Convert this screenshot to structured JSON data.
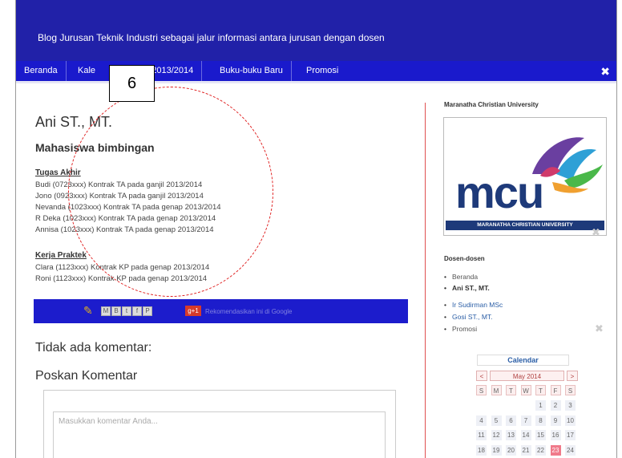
{
  "header": {
    "text": "Blog Jurusan Teknik Industri sebagai jalur informasi antara jurusan dengan dosen"
  },
  "nav": {
    "items": [
      "Beranda",
      "Kalender Akademik 2013/2014",
      "Buku-buku Baru",
      "Promosi"
    ],
    "visible_items": [
      "Beranda",
      "Kale",
      "emik 2013/2014",
      "Buku-buku Baru",
      "Promosi"
    ],
    "tools_icon": "tools-icon"
  },
  "annotation": {
    "number": "6"
  },
  "post": {
    "title": "Ani ST., MT.",
    "subtitle": "Mahasiswa bimbingan",
    "tugas_akhir": {
      "heading": "Tugas Akhir",
      "lines": [
        "Budi (0723xxx) Kontrak TA pada ganjil 2013/2014",
        "Jono (0923xxx) Kontrak TA pada ganjil 2013/2014",
        "Nevanda (1023xxx) Kontrak TA pada genap 2013/2014",
        "R Deka (1023xxx) Kontrak TA pada genap 2013/2014",
        "Annisa (1023xxx) Kontrak TA pada genap 2013/2014"
      ]
    },
    "kerja_praktek": {
      "heading": "Kerja Praktek",
      "lines": [
        "Clara (1123xxx) Kontrak KP pada genap 2013/2014",
        "Roni (1123xxx) Kontrak KP pada genap 2013/2014"
      ]
    }
  },
  "share": {
    "buttons": [
      "M",
      "B",
      "t",
      "f",
      "P"
    ],
    "gplus": "g+1",
    "recommend": "Rekomendasikan ini di Google"
  },
  "comments": {
    "none": "Tidak ada komentar:",
    "post_heading": "Poskan Komentar",
    "placeholder": "Masukkan komentar Anda..."
  },
  "sidebar": {
    "university_title": "Maranatha Christian University",
    "logo_text": "mcu",
    "logo_bar": "MARANATHA CHRISTIAN UNIVERSITY",
    "dosen_title": "Dosen-dosen",
    "dosen_items": [
      {
        "label": "Beranda",
        "type": "plain"
      },
      {
        "label": "Ani ST., MT.",
        "type": "bold"
      },
      {
        "label": "Ir Sudirman MSc",
        "type": "link"
      },
      {
        "label": "Gosi ST., MT.",
        "type": "link"
      },
      {
        "label": "Promosi",
        "type": "plain"
      }
    ],
    "calendar": {
      "title": "Calendar",
      "prev": "<",
      "next": ">",
      "month": "May 2014",
      "weekdays": [
        "S",
        "M",
        "T",
        "W",
        "T",
        "F",
        "S"
      ],
      "rows": [
        [
          "",
          "",
          "",
          "",
          "1",
          "2",
          "3"
        ],
        [
          "4",
          "5",
          "6",
          "7",
          "8",
          "9",
          "10"
        ],
        [
          "11",
          "12",
          "13",
          "14",
          "15",
          "16",
          "17"
        ],
        [
          "18",
          "19",
          "20",
          "21",
          "22",
          "23",
          "24"
        ]
      ],
      "today": "23"
    }
  },
  "colors": {
    "header_bg": "#2121a8",
    "nav_bg": "#1a1acc",
    "share_bg": "#1c1ccc",
    "link": "#2b5ea6",
    "annotation": "#e02020"
  }
}
